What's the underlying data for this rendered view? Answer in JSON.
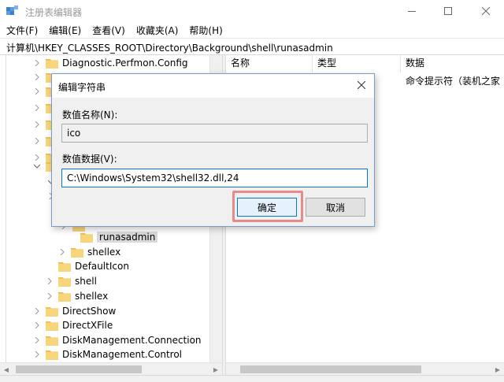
{
  "window": {
    "title": "注册表编辑器",
    "accent_color": "#0078d7"
  },
  "menu": [
    {
      "label": "文件(F)"
    },
    {
      "label": "编辑(E)"
    },
    {
      "label": "查看(V)"
    },
    {
      "label": "收藏夹(A)"
    },
    {
      "label": "帮助(H)"
    }
  ],
  "address": "计算机\\HKEY_CLASSES_ROOT\\Directory\\Background\\shell\\runasadmin",
  "tree": [
    {
      "label": "Diagnostic.Perfmon.Config",
      "icon": "folder-icon"
    },
    {
      "label": "",
      "icon": "folder-icon"
    },
    {
      "label": "",
      "icon": "folder-icon"
    },
    {
      "label": "",
      "icon": "folder-icon"
    },
    {
      "label": "",
      "icon": "folder-icon"
    },
    {
      "label": "",
      "icon": "folder-icon"
    },
    {
      "label": "",
      "icon": "folder-icon"
    },
    {
      "label": "",
      "icon": "folder-icon"
    },
    {
      "label": "",
      "icon": "folder-icon"
    },
    {
      "label": "",
      "icon": "folder-icon"
    },
    {
      "label": "",
      "icon": "folder-icon"
    },
    {
      "label": "",
      "icon": "folder-icon"
    },
    {
      "label": "runasadmin",
      "icon": "folder-icon",
      "selected": true
    },
    {
      "label": "shellex",
      "icon": "folder-icon"
    },
    {
      "label": "DefaultIcon",
      "icon": "folder-icon"
    },
    {
      "label": "shell",
      "icon": "folder-icon"
    },
    {
      "label": "shellex",
      "icon": "folder-icon"
    },
    {
      "label": "DirectShow",
      "icon": "folder-icon"
    },
    {
      "label": "DirectXFile",
      "icon": "folder-icon"
    },
    {
      "label": "DiskManagement.Connection",
      "icon": "folder-icon"
    },
    {
      "label": "DiskManagement.Control",
      "icon": "folder-icon"
    }
  ],
  "list": {
    "columns": [
      "名称",
      "类型",
      "数据"
    ],
    "rows": [
      {
        "name": "",
        "type": "",
        "data": "命令提示符（装机之家"
      }
    ]
  },
  "dialog": {
    "title": "编辑字符串",
    "name_label": "数值名称(N):",
    "name_value": "ico",
    "data_label": "数值数据(V):",
    "data_value": "C:\\Windows\\System32\\shell32.dll,24",
    "ok_label": "确定",
    "cancel_label": "取消",
    "highlight_color": "#e68a8a"
  }
}
